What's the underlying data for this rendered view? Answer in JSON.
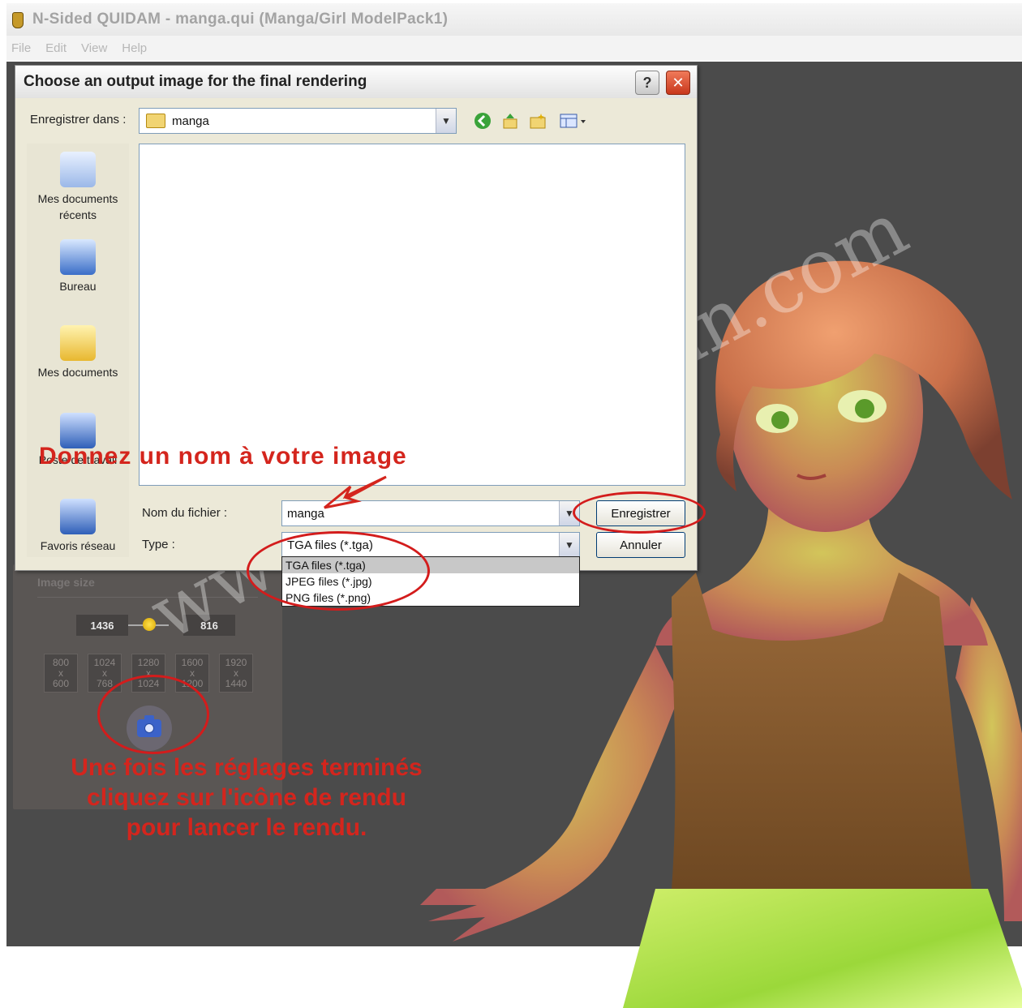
{
  "window": {
    "title": "N-Sided QUIDAM - manga.qui (Manga/Girl ModelPack1)"
  },
  "menu": [
    "File",
    "Edit",
    "View",
    "Help"
  ],
  "render_panel": {
    "title": "Image size",
    "width_value": "1436",
    "height_value": "816",
    "presets": [
      {
        "w": "800",
        "x": "x",
        "h": "600"
      },
      {
        "w": "1024",
        "x": "x",
        "h": "768"
      },
      {
        "w": "1280",
        "x": "x",
        "h": "1024"
      },
      {
        "w": "1600",
        "x": "x",
        "h": "1200"
      },
      {
        "w": "1920",
        "x": "x",
        "h": "1440"
      }
    ],
    "render_icon": "camera-icon"
  },
  "dialog": {
    "title": "Choose an output image for the final rendering",
    "help_label": "?",
    "close_label": "✕",
    "save_in_label": "Enregistrer dans :",
    "save_in_value": "manga",
    "places": [
      "Mes documents récents",
      "Bureau",
      "Mes documents",
      "Poste de travail",
      "Favoris réseau"
    ],
    "filename_label": "Nom du fichier :",
    "filename_value": "manga",
    "type_label": "Type :",
    "type_value": "TGA files (*.tga)",
    "type_options": [
      "TGA files (*.tga)",
      "JPEG files (*.jpg)",
      "PNG files (*.png)"
    ],
    "save_button": "Enregistrer",
    "cancel_button": "Annuler"
  },
  "annotations": {
    "name_hint": "Donnez un nom à votre image",
    "render_hint_1": "Une fois les réglages terminés",
    "render_hint_2": "cliquez sur l'icône de rendu",
    "render_hint_3": "pour lancer le rendu.",
    "watermark": "www.3d-diablotin.com"
  },
  "colors": {
    "annotation_red": "#d4251d",
    "viewport_bg": "#4b4b4b",
    "dialog_bg": "#ece9d8"
  }
}
